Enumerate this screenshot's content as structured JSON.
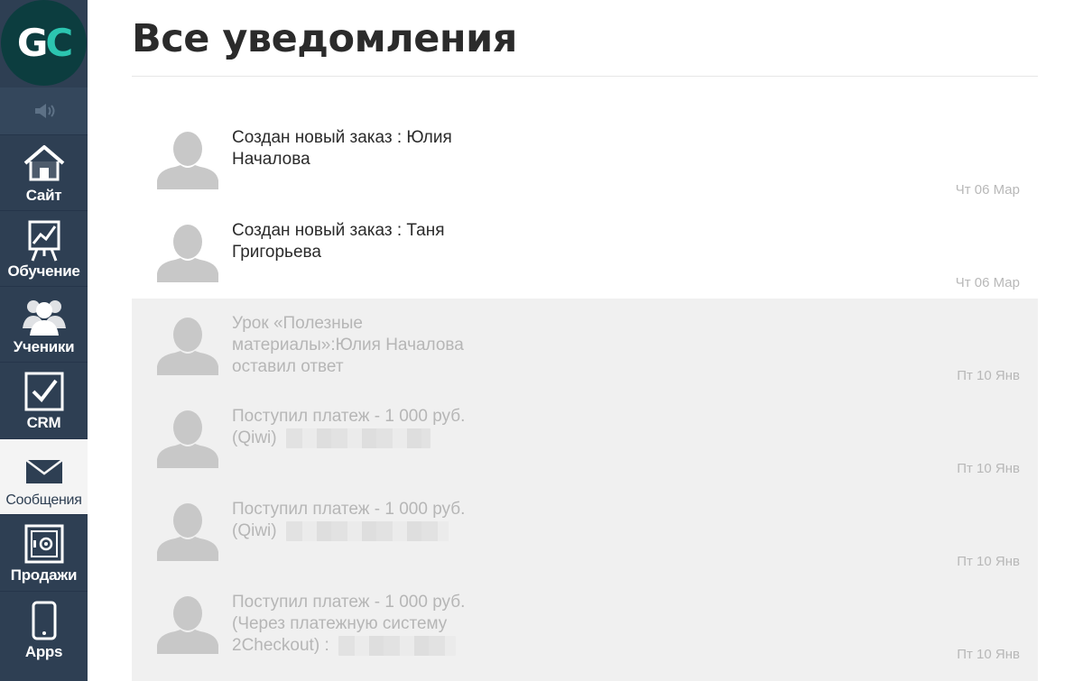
{
  "logo": {
    "letter1": "G",
    "letter2": "C"
  },
  "icons": {
    "sound": "speaker-icon"
  },
  "sidebar": {
    "items": [
      {
        "label": "Сайт",
        "icon": "home-icon",
        "active": false
      },
      {
        "label": "Обучение",
        "icon": "chart-board-icon",
        "active": false
      },
      {
        "label": "Ученики",
        "icon": "users-icon",
        "active": false
      },
      {
        "label": "CRM",
        "icon": "checkbox-icon",
        "active": false
      },
      {
        "label": "Сообщения",
        "icon": "envelope-icon",
        "active": true
      },
      {
        "label": "Продажи",
        "icon": "safe-icon",
        "active": false
      },
      {
        "label": "Apps",
        "icon": "phone-icon",
        "active": false
      }
    ]
  },
  "page": {
    "title": "Все уведомления"
  },
  "notifications": [
    {
      "line1": "Создан новый заказ : Юлия",
      "line2": "Началова",
      "line3": "",
      "date": "Чт 06 Мар",
      "read": false
    },
    {
      "line1": "Создан новый заказ : Таня",
      "line2": "Григорьева",
      "line3": "",
      "date": "Чт 06 Мар",
      "read": false
    },
    {
      "line1": "Урок «Полезные",
      "line2": "материалы»:Юлия Началова",
      "line3": "оставил ответ",
      "date": "Пт 10 Янв",
      "read": true
    },
    {
      "line1": "Поступил платеж - 1 000 руб.",
      "line2": "(Qiwi)",
      "line3": "",
      "date": "Пт 10 Янв",
      "read": true
    },
    {
      "line1": "Поступил платеж - 1 000 руб.",
      "line2": "(Qiwi)",
      "line3": "",
      "date": "Пт 10 Янв",
      "read": true
    },
    {
      "line1": "Поступил платеж - 1 000 руб.",
      "line2": "(Через платежную систему",
      "line3": "2Checkout) :",
      "date": "Пт 10 Янв",
      "read": true
    }
  ],
  "colors": {
    "sidebar": "#2e3f53",
    "accent": "#2cc5b0",
    "read_bg": "#f0f0f0"
  }
}
